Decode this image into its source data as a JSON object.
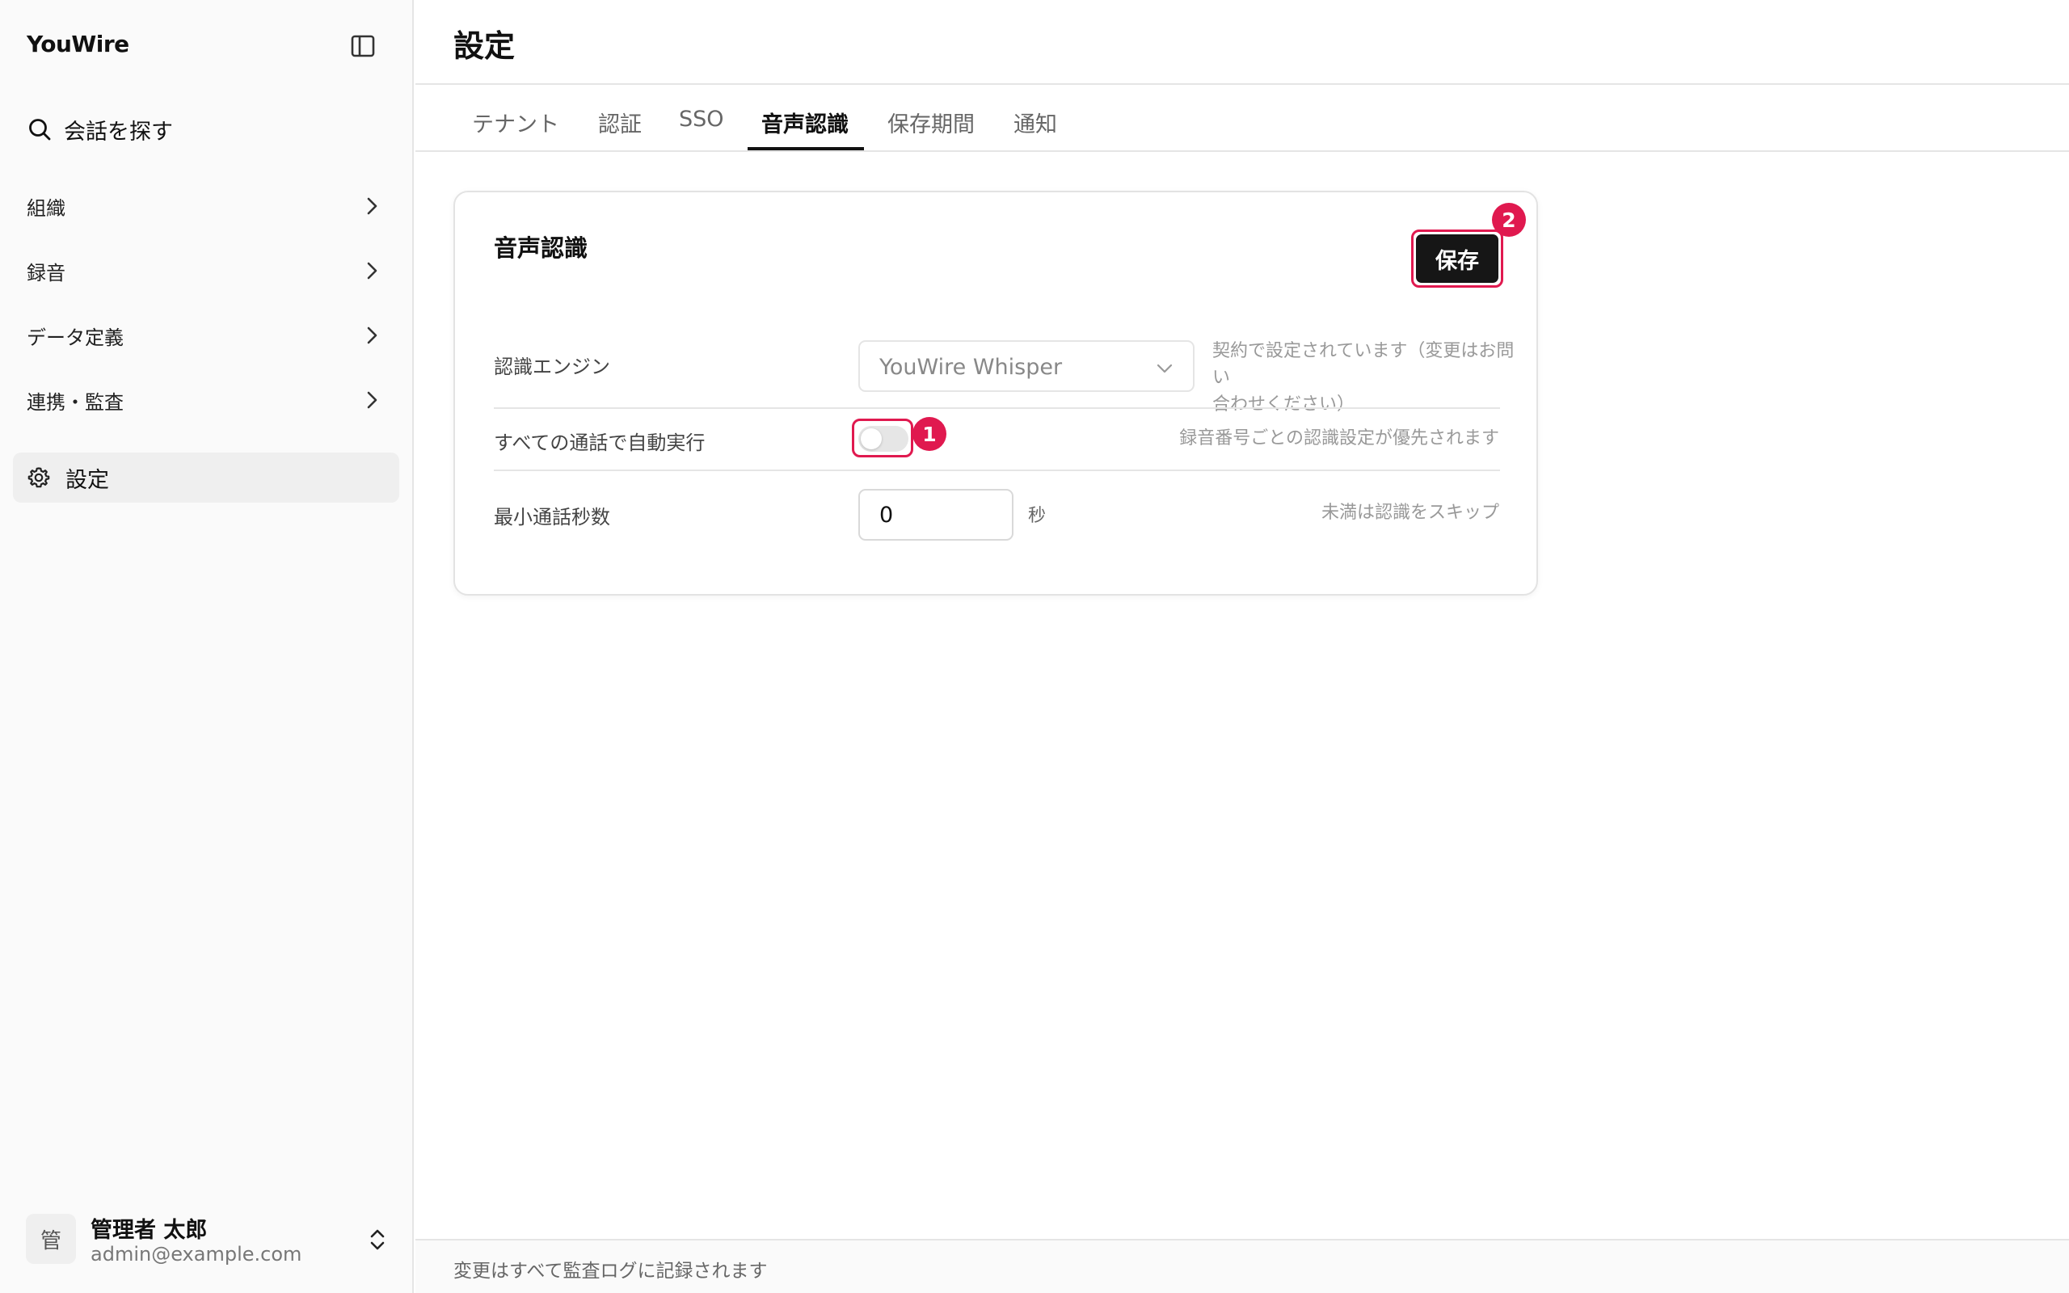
{
  "app": {
    "brand": "YouWire"
  },
  "sidebar": {
    "search_label": "会話を探す",
    "items": [
      {
        "label": "組織"
      },
      {
        "label": "録音"
      },
      {
        "label": "データ定義"
      },
      {
        "label": "連携・監査"
      },
      {
        "label": "設定",
        "active": true
      }
    ],
    "user": {
      "avatar": "管",
      "name": "管理者 太郎",
      "email": "admin@example.com"
    }
  },
  "page": {
    "title": "設定",
    "tabs": [
      {
        "label": "テナント"
      },
      {
        "label": "認証"
      },
      {
        "label": "SSO"
      },
      {
        "label": "音声認識",
        "active": true
      },
      {
        "label": "保存期間"
      },
      {
        "label": "通知"
      }
    ]
  },
  "card": {
    "title": "音声認識",
    "save_label": "保存",
    "save_badge": "2",
    "rows": [
      {
        "label": "認識エンジン",
        "value": "YouWire Whisper",
        "hint_line1": "契約で設定されています（変更はお問い",
        "hint_line2": "合わせください）"
      },
      {
        "label": "すべての通話で自動実行",
        "toggle_on": false,
        "badge": "1",
        "hint": "録音番号ごとの認識設定が優先されます"
      },
      {
        "label": "最小通話秒数",
        "value": "0",
        "unit": "秒",
        "hint": "未満は認識をスキップ"
      }
    ]
  },
  "footer": {
    "text": "変更はすべて監査ログに記録されます"
  },
  "colors": {
    "highlight": "#e0194f",
    "primary_button": "#161616"
  },
  "icons": [
    "sidebar-panel-icon",
    "search-icon",
    "chevron-right-icon",
    "gear-icon",
    "chevron-down-icon",
    "chevron-up-down-icon"
  ]
}
